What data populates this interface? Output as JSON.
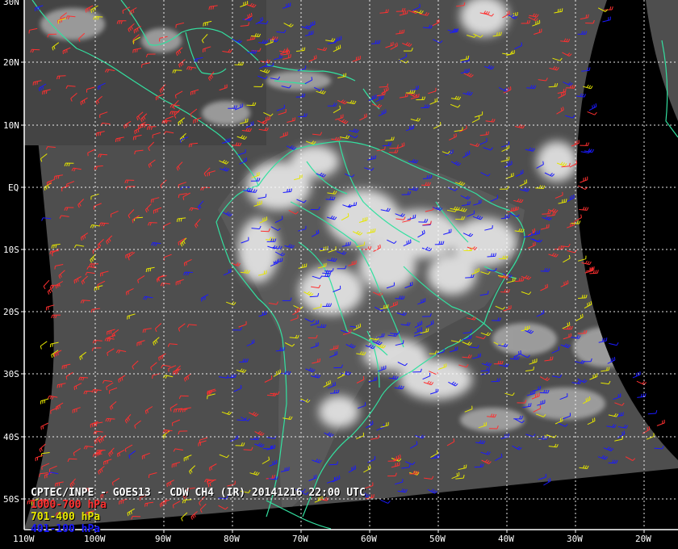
{
  "image": {
    "title": "CPTEC/INPE - GOES13 - CDW CH4 (IR) 20141216 22:00 UTC",
    "legend": [
      {
        "label": "1000-700 hPa",
        "color": "#ff3030"
      },
      {
        "label": "701-400 hPa",
        "color": "#e6e600"
      },
      {
        "label": "401-100 hPa",
        "color": "#1a1aff"
      }
    ],
    "coastline_color": "#33e0a0",
    "grid_color": "#ffffff"
  },
  "axes": {
    "lat_labels": [
      "30N",
      "20N",
      "10N",
      "EQ",
      "10S",
      "20S",
      "30S",
      "40S",
      "50S"
    ],
    "lon_labels": [
      "110W",
      "100W",
      "90W",
      "80W",
      "70W",
      "60W",
      "50W",
      "40W",
      "30W",
      "20W"
    ]
  }
}
